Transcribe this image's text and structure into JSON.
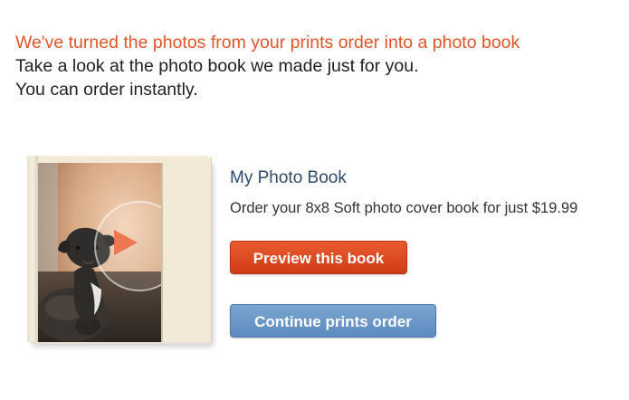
{
  "intro": {
    "headline": "We've turned the photos from your prints order into a photo book",
    "line1": "Take a look at the photo book we made just for you.",
    "line2": "You can order instantly."
  },
  "book": {
    "title": "My Photo Book",
    "description": "Order your 8x8 Soft photo cover book for just $19.99",
    "cover_icon": "play-icon"
  },
  "actions": {
    "preview_label": "Preview this book",
    "continue_label": "Continue prints order"
  },
  "colors": {
    "headline": "#e0562a",
    "title": "#2f4a6b",
    "preview_button": "#d9481f",
    "continue_button": "#6a96c8"
  }
}
